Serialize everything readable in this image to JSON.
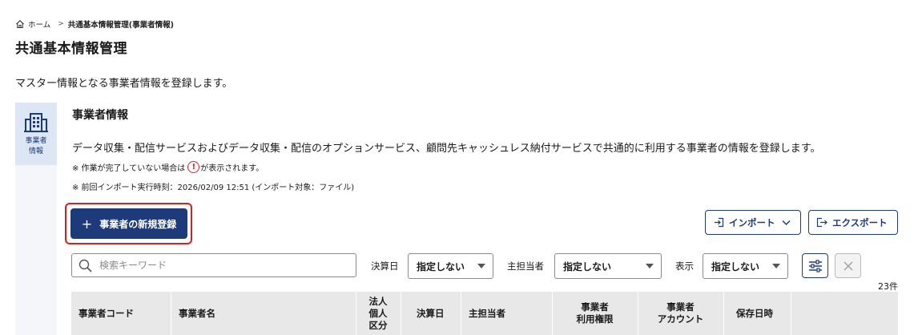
{
  "breadcrumb": {
    "home": "ホーム",
    "separator": ">",
    "current": "共通基本情報管理(事業者情報)"
  },
  "page": {
    "title": "共通基本情報管理",
    "description": "マスター情報となる事業者情報を登録します。"
  },
  "side_tab": {
    "icon": "building-icon",
    "line1": "事業者",
    "line2": "情報"
  },
  "section": {
    "title": "事業者情報",
    "description": "データ収集・配信サービスおよびデータ収集・配信のオプションサービス、顧問先キャッシュレス納付サービスで共通的に利用する事業者の情報を登録します。",
    "note_incomplete_prefix": "※ 作業が完了していない場合は",
    "note_incomplete_icon": "!",
    "note_incomplete_suffix": "が表示されます。",
    "note_import": "※ 前回インポート実行時刻：2026/02/09 12:51 (インポート対象：ファイル)"
  },
  "actions": {
    "new_plus": "+",
    "new_label": "事業者の新規登録",
    "import_label": "インポート",
    "export_label": "エクスポート"
  },
  "filters": {
    "search_placeholder": "検索キーワード",
    "closing_label": "決算日",
    "closing_value": "指定しない",
    "owner_label": "主担当者",
    "owner_value": "指定しない",
    "display_label": "表示",
    "display_value": "指定しない"
  },
  "count": "23件",
  "table": {
    "headers": {
      "code": "事業者コード",
      "name": "事業者名",
      "type_l1": "法人",
      "type_l2": "個人",
      "type_l3": "区分",
      "closing": "決算日",
      "owner": "主担当者",
      "rights_l1": "事業者",
      "rights_l2": "利用権限",
      "account_l1": "事業者",
      "account_l2": "アカウント",
      "saved": "保存日時"
    }
  },
  "colors": {
    "primary": "#1d3b7a",
    "alert": "#d62020",
    "header_bg": "#e8e8e8",
    "tab_bg": "#dde6f4"
  }
}
